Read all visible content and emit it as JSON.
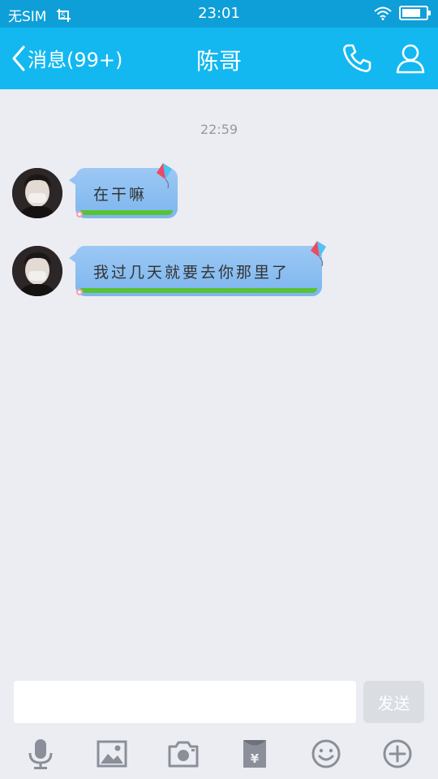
{
  "status_bar": {
    "carrier": "无SIM",
    "time": "23:01",
    "battery_level": 0.7,
    "icons": [
      "screenshot-icon",
      "wifi-icon",
      "battery-icon"
    ]
  },
  "nav": {
    "back_label": "消息(99+)",
    "title": "陈哥",
    "icons": [
      "back-arrow-icon",
      "phone-icon",
      "profile-icon"
    ]
  },
  "chat": {
    "timestamp": "22:59",
    "messages": [
      {
        "sender": "contact",
        "text": "在干嘛"
      },
      {
        "sender": "contact",
        "text": "我过几天就要去你那里了"
      }
    ]
  },
  "input": {
    "value": "",
    "send_label": "发送"
  },
  "toolbar": {
    "icons": [
      "microphone-icon",
      "image-icon",
      "camera-icon",
      "red-packet-icon",
      "emoji-icon",
      "plus-icon"
    ]
  },
  "colors": {
    "status_bar": "#0f9fd8",
    "nav_bar": "#13b8f0",
    "background": "#ebedf2",
    "bubble": "#8ec0f2",
    "bubble_grass": "#59c233",
    "toolbar_icon": "#8a8f99"
  }
}
